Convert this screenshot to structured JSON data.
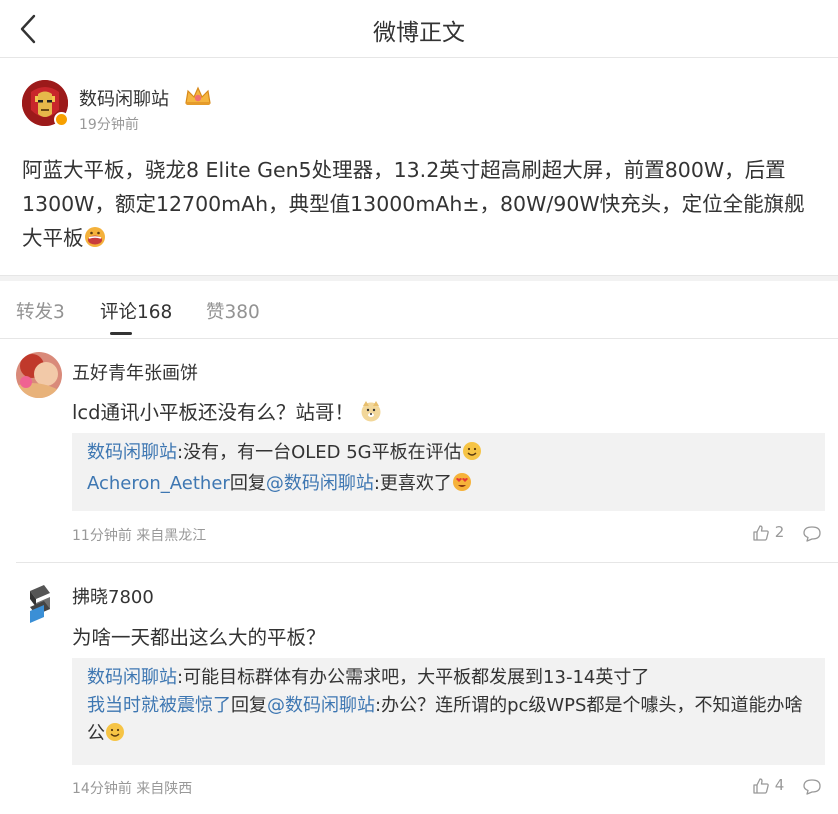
{
  "header": {
    "back_icon": "chevron-left-icon",
    "title": "微博正文"
  },
  "post": {
    "author": "数码闲聊站",
    "badge_icon": "crown-icon",
    "time": "19分钟前",
    "text": "阿蓝大平板，骁龙8 Elite Gen5处理器，13.2英寸超高刷超大屏，前置800W，后置1300W，额定12700mAh，典型值13000mAh±，80W/90W快充头，定位全能旗舰大平板",
    "text_emoji": "drooling-face-emoji"
  },
  "tabs": {
    "repost": "转发3",
    "comments": "评论168",
    "likes": "赞380"
  },
  "comments": [
    {
      "name": "五好青年张画饼",
      "text": "lcd通讯小平板还没有么？站哥！",
      "text_emoji": "doge-emoji",
      "replies": [
        {
          "author": "数码闲聊站",
          "text": ":没有，有一台OLED 5G平板在评估",
          "emoji": "smile-emoji"
        },
        {
          "author": "Acheron_Aether",
          "reply_word": "回复",
          "mention": "@数码闲聊站",
          "text": ":更喜欢了",
          "emoji": "heart-eyes-emoji"
        }
      ],
      "meta": "11分钟前 来自黑龙江",
      "likes": "2"
    },
    {
      "name": "拂晓7800",
      "text": "为啥一天都出这么大的平板？",
      "replies": [
        {
          "author": "数码闲聊站",
          "text": ":可能目标群体有办公需求吧，大平板都发展到13-14英寸了"
        },
        {
          "author": "我当时就被震惊了",
          "reply_word": "回复",
          "mention": "@数码闲聊站",
          "text": ":办公？连所谓的pc级WPS都是个噱头，不知道能办啥公",
          "emoji": "smile-emoji"
        }
      ],
      "meta": "14分钟前 来自陕西",
      "likes": "4"
    }
  ],
  "colors": {
    "link": "#3e77b2",
    "secondary_text": "#999999",
    "reply_bg": "#f2f2f2",
    "verified_badge": "#f7a000"
  }
}
